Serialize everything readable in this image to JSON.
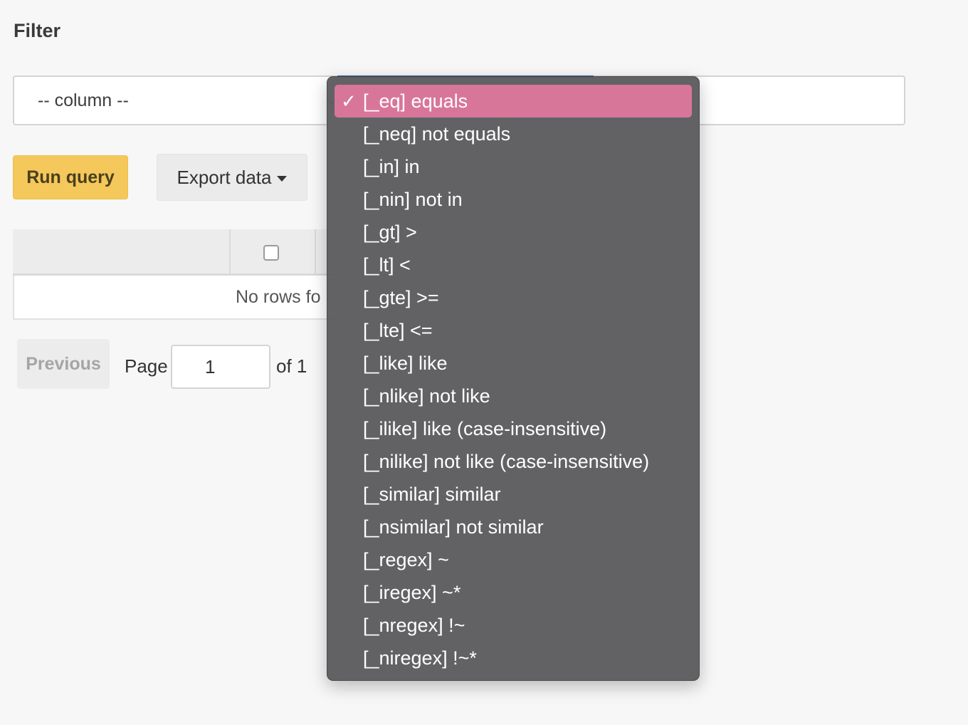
{
  "filter": {
    "title": "Filter",
    "column_placeholder": "-- column --"
  },
  "toolbar": {
    "run_label": "Run query",
    "export_label": "Export data"
  },
  "table": {
    "empty_text": "No rows fo"
  },
  "pagination": {
    "previous_label": "Previous",
    "page_label": "Page",
    "page_value": "1",
    "of_label": "of 1"
  },
  "operator_dropdown": {
    "selected_index": 0,
    "check_glyph": "✓",
    "options": [
      "[_eq] equals",
      "[_neq] not equals",
      "[_in] in",
      "[_nin] not in",
      "[_gt] >",
      "[_lt] <",
      "[_gte] >=",
      "[_lte] <=",
      "[_like] like",
      "[_nlike] not like",
      "[_ilike] like (case-insensitive)",
      "[_nilike] not like (case-insensitive)",
      "[_similar] similar",
      "[_nsimilar] not similar",
      "[_regex] ~",
      "[_iregex] ~*",
      "[_nregex] !~",
      "[_niregex] !~*"
    ]
  },
  "colors": {
    "accent_yellow": "#f5c85b",
    "selected_pink": "#d8769a",
    "dropdown_bg": "#5c5c5e"
  }
}
